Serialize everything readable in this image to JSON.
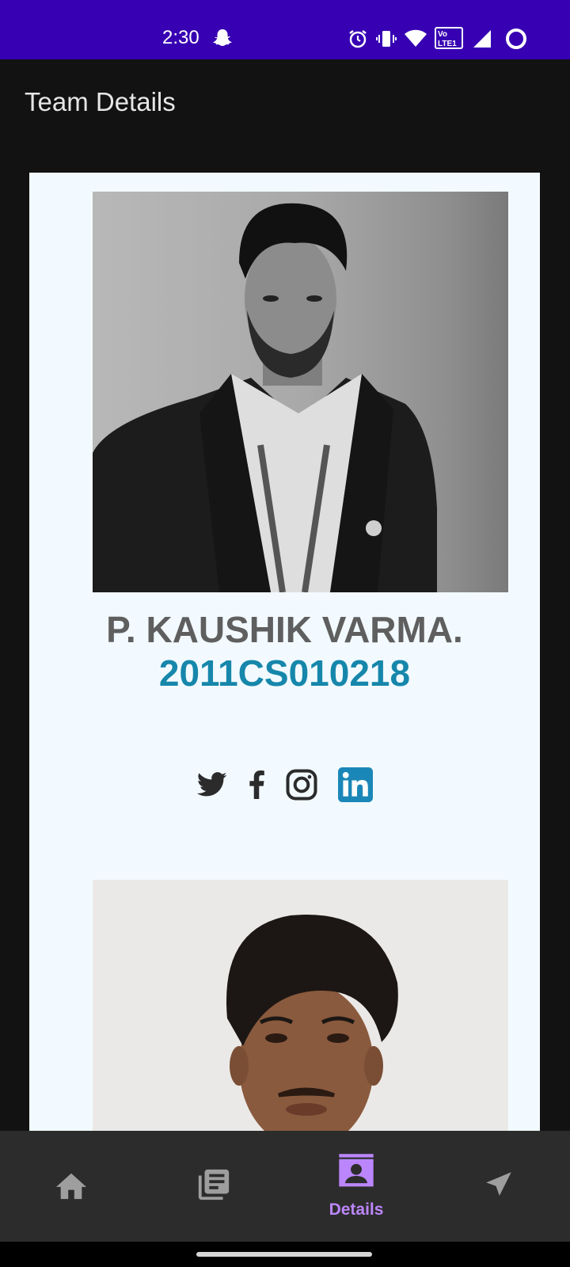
{
  "status_bar": {
    "time": "2:30",
    "icons": [
      "snapchat-icon",
      "alarm-icon",
      "vibrate-icon",
      "wifi-icon",
      "volte-icon",
      "signal-icon",
      "battery-saver-icon"
    ],
    "lte_label": "Vo LTE1"
  },
  "app_bar": {
    "title": "Team Details"
  },
  "members": [
    {
      "name": "P. KAUSHIK VARMA.",
      "roll": "2011CS010218",
      "socials": [
        "twitter-icon",
        "facebook-icon",
        "instagram-icon",
        "linkedin-icon"
      ]
    },
    {
      "name": "",
      "roll": ""
    }
  ],
  "bottom_nav": {
    "items": [
      {
        "icon": "home-icon",
        "label": ""
      },
      {
        "icon": "library-icon",
        "label": ""
      },
      {
        "icon": "contact-card-icon",
        "label": "Details",
        "selected": true
      },
      {
        "icon": "send-icon",
        "label": ""
      }
    ]
  },
  "colors": {
    "status_bar": "#3700b3",
    "background": "#121212",
    "card": "#f2faff",
    "name_text": "#5f5f5f",
    "roll_text": "#1687ab",
    "nav_background": "#2c2c2c",
    "nav_selected": "#bb86fc",
    "nav_unselected": "#9e9e9e",
    "linkedin": "#1b87b8"
  }
}
